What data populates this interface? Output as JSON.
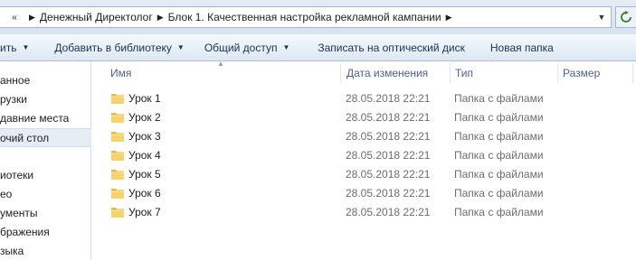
{
  "address_bar": {
    "breadcrumbs": [
      "Денежный Директолог",
      "Блок 1. Качественная настройка рекламной кампании"
    ]
  },
  "command_bar": {
    "organize_label": "ить",
    "add_to_library_label": "Добавить в библиотеку",
    "share_label": "Общий доступ",
    "burn_label": "Записать на оптический диск",
    "new_folder_label": "Новая папка"
  },
  "navigation": {
    "items": [
      "анное",
      "рузки",
      "давние места",
      "очий стол",
      "",
      "иотеки",
      "ео",
      "ументы",
      "бражения",
      "зыка"
    ]
  },
  "file_list": {
    "columns": {
      "name": "Имя",
      "date_modified": "Дата изменения",
      "type": "Тип",
      "size": "Размер"
    },
    "rows": [
      {
        "name": "Урок 1",
        "date": "28.05.2018 22:21",
        "type": "Папка с файлами",
        "size": ""
      },
      {
        "name": "Урок 2",
        "date": "28.05.2018 22:21",
        "type": "Папка с файлами",
        "size": ""
      },
      {
        "name": "Урок 3",
        "date": "28.05.2018 22:21",
        "type": "Папка с файлами",
        "size": ""
      },
      {
        "name": "Урок 4",
        "date": "28.05.2018 22:21",
        "type": "Папка с файлами",
        "size": ""
      },
      {
        "name": "Урок 5",
        "date": "28.05.2018 22:21",
        "type": "Папка с файлами",
        "size": ""
      },
      {
        "name": "Урок 6",
        "date": "28.05.2018 22:21",
        "type": "Папка с файлами",
        "size": ""
      },
      {
        "name": "Урок 7",
        "date": "28.05.2018 22:21",
        "type": "Папка с файлами",
        "size": ""
      }
    ]
  },
  "icons": {
    "folder": "folder-icon",
    "refresh": "refresh-icon",
    "dropdown": "chevron-down-icon"
  },
  "colors": {
    "folder_yellow": "#f2c94c",
    "header_text": "#4d6185",
    "selected_bg": "#e7edf4"
  }
}
